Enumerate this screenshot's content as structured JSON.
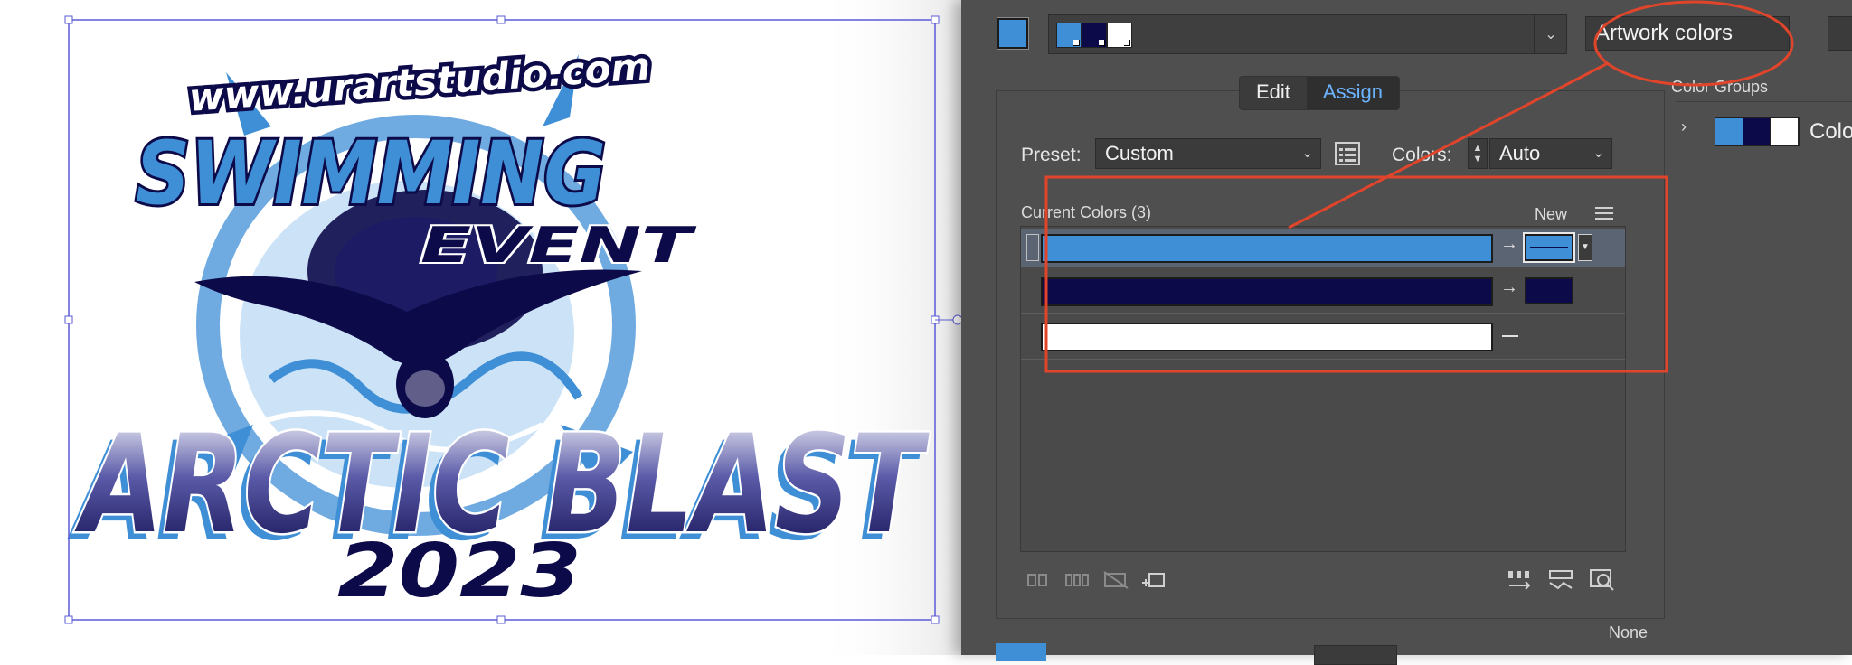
{
  "artwork": {
    "url_text": "www.urartstudio.com",
    "line1": "SWIMMING",
    "line2": "EVENT",
    "line3": "ARCTIC BLAST",
    "line4": "2023"
  },
  "panel": {
    "name_field": "Artwork colors",
    "tabs": [
      {
        "label": "Edit",
        "active": false
      },
      {
        "label": "Assign",
        "active": true
      }
    ],
    "preset_label": "Preset:",
    "preset_value": "Custom",
    "colors_label": "Colors:",
    "colors_value": "Auto",
    "current_colors_header": "Current Colors (3)",
    "new_header": "New",
    "rows": [
      {
        "current": "#3f8fd6",
        "new": "#3f8fd6",
        "mapped": true,
        "selected": true
      },
      {
        "current": "#0d0a4a",
        "new": "#0d0a4a",
        "mapped": true,
        "selected": false
      },
      {
        "current": "#ffffff",
        "new": "",
        "mapped": false,
        "selected": false
      }
    ],
    "none_label": "None",
    "color_groups_title": "Color Groups",
    "color_group_label": "Color",
    "group_swatches": [
      "#3f8fd6",
      "#0d0a4a",
      "#ffffff"
    ]
  },
  "colors": {
    "accent_blue": "#3f8fd6",
    "navy": "#0d0a4a",
    "annotation_red": "#e0452b",
    "selection_blue": "#5a5ad6"
  },
  "icons": [
    "dropdown-chevron-icon",
    "color-reduction-options-icon",
    "stepper-icon",
    "hamburger-menu-icon",
    "arrow-right-icon",
    "merge-colors-icon",
    "separate-colors-icon",
    "exclude-colors-icon",
    "new-row-icon",
    "randomly-change-order-icon",
    "randomly-change-saturation-icon",
    "find-color-icon",
    "chevron-right-icon"
  ]
}
